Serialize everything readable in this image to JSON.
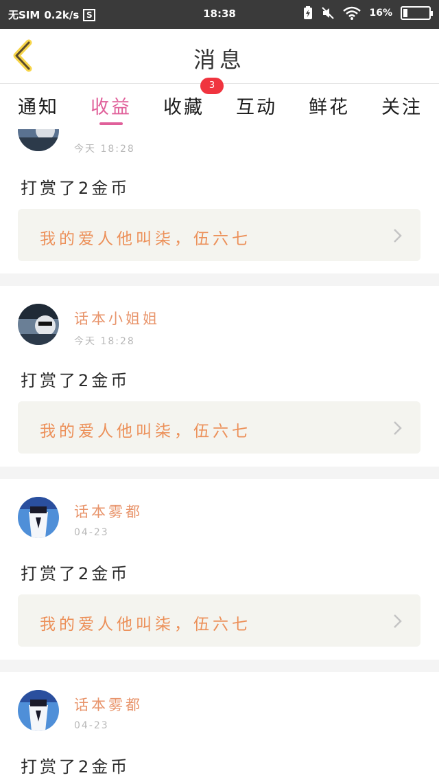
{
  "status_bar": {
    "sim": "无SIM",
    "speed": "0.2k/s",
    "sim_icon_text": "S",
    "time": "18:38",
    "battery_percent": "16",
    "battery_level": 0.16
  },
  "header": {
    "back_icon": "chevron-left-icon",
    "title": "消息"
  },
  "tabs": [
    {
      "label": "通知"
    },
    {
      "label": "收益",
      "active": true
    },
    {
      "label": "收藏",
      "badge": "3"
    },
    {
      "label": "互动"
    },
    {
      "label": "鲜花"
    },
    {
      "label": "关注"
    }
  ],
  "items": [
    {
      "user": "",
      "time": "今天 18:28",
      "message": "打赏了2金币",
      "book": "我的爱人他叫柒，伍六七"
    },
    {
      "user": "话本小姐姐",
      "time": "今天 18:28",
      "message": "打赏了2金币",
      "book": "我的爱人他叫柒，伍六七"
    },
    {
      "user": "话本雾都",
      "time": "04-23",
      "message": "打赏了2金币",
      "book": "我的爱人他叫柒，伍六七"
    },
    {
      "user": "话本雾都",
      "time": "04-23",
      "message": "打赏了2金币"
    }
  ],
  "colors": {
    "accent": "#e0609a",
    "username": "#e8946b",
    "link_text": "#ec9059",
    "badge": "#f0343f"
  }
}
